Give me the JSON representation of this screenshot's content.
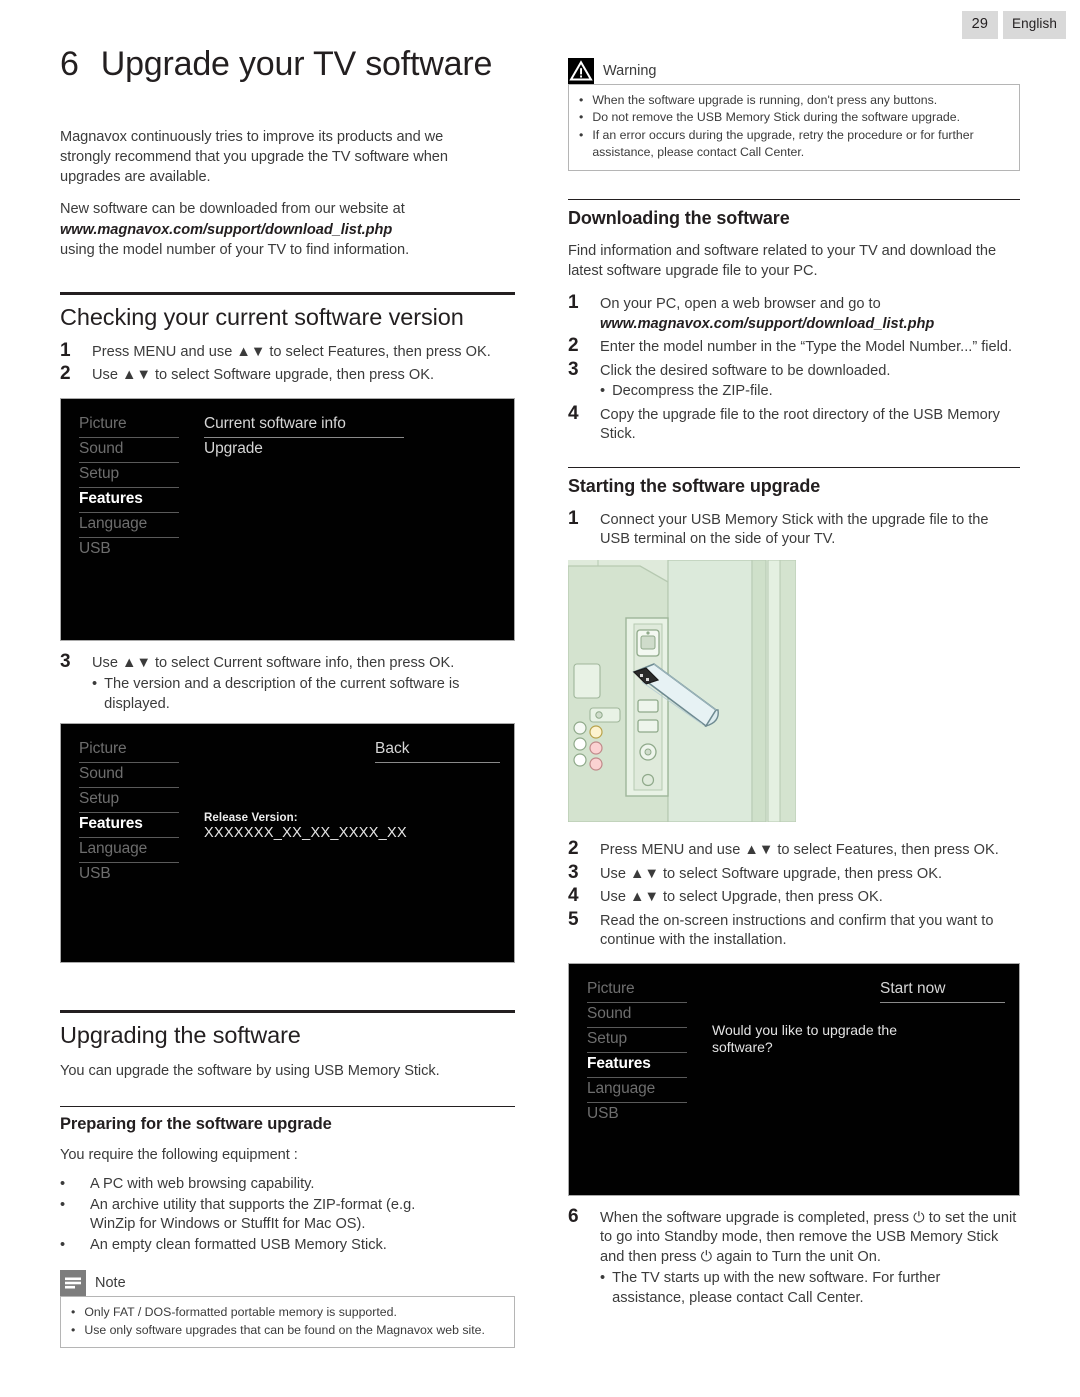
{
  "header": {
    "page_number": "29",
    "language": "English"
  },
  "chapter": {
    "number": "6",
    "title": "Upgrade your TV software"
  },
  "intro": {
    "p1": "Magnavox continuously tries to improve its products and we strongly recommend that you upgrade the TV software when upgrades are available.",
    "p2_lead": "New software can be downloaded from our website at",
    "p2_url": "www.magnavox.com/support/download_list.php",
    "p2_tail": "using the model number of your TV to find information."
  },
  "checking": {
    "heading": "Checking your current software version",
    "steps": [
      {
        "num": "1",
        "text": "Press MENU and use ▲▼ to select Features, then press OK."
      },
      {
        "num": "2",
        "text": "Use ▲▼ to select Software upgrade, then press OK."
      }
    ],
    "step3": {
      "num": "3",
      "text": "Use ▲▼ to select Current software info, then press OK."
    },
    "step3_bullet": "The version and a description of the current software is displayed."
  },
  "osd": {
    "menu_items": [
      "Picture",
      "Sound",
      "Setup",
      "Features",
      "Language",
      "USB"
    ],
    "active_item": "Features",
    "screen1": {
      "options": [
        "Current software info",
        "Upgrade"
      ]
    },
    "screen2": {
      "back_label": "Back",
      "release_label": "Release Version:",
      "release_value": "XXXXXXX_XX_XX_XXXX_XX"
    },
    "screen3": {
      "start_label": "Start now",
      "message": "Would you like to upgrade the software?"
    }
  },
  "upgrading": {
    "heading": "Upgrading the software",
    "body": "You can upgrade the software by using USB Memory Stick.",
    "preparing_heading": "Preparing for the software upgrade",
    "preparing_lead": "You require the following equipment :",
    "requirements": [
      "A PC with web browsing capability.",
      "An archive utility that supports the ZIP-format (e.g. WinZip for Windows or StuffIt for Mac OS).",
      "An empty clean formatted USB Memory Stick."
    ]
  },
  "note": {
    "icon": "note-icon",
    "title": "Note",
    "items": [
      "Only FAT / DOS-formatted portable memory is supported.",
      "Use only software upgrades that can be found on the Magnavox web site."
    ]
  },
  "warning": {
    "icon": "warning-icon",
    "title": "Warning",
    "items": [
      "When the software upgrade is running, don't press any buttons.",
      "Do not remove the USB Memory Stick during the software upgrade.",
      "If an error occurs during the upgrade, retry the procedure or for further assistance, please contact Call Center."
    ]
  },
  "downloading": {
    "heading": "Downloading the software",
    "body": "Find information and software related to your TV and download the latest software upgrade file to your PC.",
    "step1_num": "1",
    "step1_text": "On your PC, open a web browser and go to",
    "step1_url": "www.magnavox.com/support/download_list.php",
    "step2_num": "2",
    "step2_text": "Enter the model number in the “Type the Model Number...” field.",
    "step3_num": "3",
    "step3_text": "Click the desired software to be downloaded.",
    "step3_bullet": "Decompress the ZIP-file.",
    "step4_num": "4",
    "step4_text": "Copy the upgrade file to the root directory of the USB Memory Stick."
  },
  "starting": {
    "heading": "Starting the software upgrade",
    "step1_num": "1",
    "step1_text": "Connect your USB Memory Stick with the upgrade file to the USB terminal on the side of your TV.",
    "steps": [
      {
        "num": "2",
        "text": "Press MENU and use ▲▼ to select Features, then press OK."
      },
      {
        "num": "3",
        "text": "Use ▲▼ to select Software upgrade, then press OK."
      },
      {
        "num": "4",
        "text": "Use ▲▼ to select Upgrade, then press OK."
      },
      {
        "num": "5",
        "text": "Read the on-screen instructions and confirm that you want to continue with the installation."
      }
    ],
    "step6_num": "6",
    "step6_text": "When the software upgrade is completed, press ⏻ to set the unit to go into Standby mode, then remove the USB Memory Stick and then press ⏻ again to Turn the unit On.",
    "step6_bullet": "The TV starts up with the new software. For further assistance, please contact Call Center."
  },
  "colors": {
    "badge_bg": "#d9d9d9",
    "osd_bg": "#010101",
    "note_icon_bg": "#7d7d7d",
    "illustration": "#d8e6d4"
  }
}
